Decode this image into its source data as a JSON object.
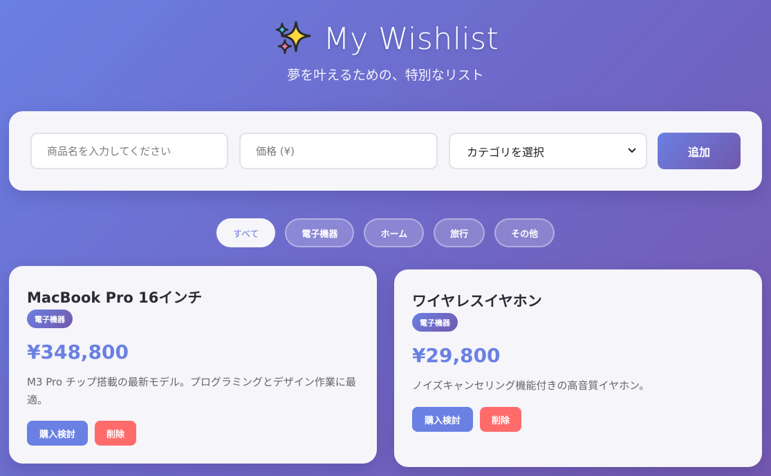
{
  "header": {
    "title": "My Wishlist",
    "subtitle": "夢を叶えるための、特別なリスト",
    "icon": "sparkles-icon"
  },
  "form": {
    "name_placeholder": "商品名を入力してください",
    "price_placeholder": "価格 (¥)",
    "category_selected": "カテゴリを選択",
    "add_label": "追加"
  },
  "filters": [
    {
      "label": "すべて",
      "active": true
    },
    {
      "label": "電子機器",
      "active": false
    },
    {
      "label": "ホーム",
      "active": false
    },
    {
      "label": "旅行",
      "active": false
    },
    {
      "label": "その他",
      "active": false
    }
  ],
  "items": [
    {
      "name": "MacBook Pro 16インチ",
      "category": "電子機器",
      "price": "¥348,800",
      "description": "M3 Pro チップ搭載の最新モデル。プログラミングとデザイン作業に最適。",
      "consider_label": "購入検討",
      "delete_label": "削除"
    },
    {
      "name": "ワイヤレスイヤホン",
      "category": "電子機器",
      "price": "¥29,800",
      "description": "ノイズキャンセリング機能付きの高音質イヤホン。",
      "consider_label": "購入検討",
      "delete_label": "削除"
    }
  ],
  "colors": {
    "accent": "#6a80e2",
    "accent_dark": "#7258ad",
    "delete": "#ff6b6b",
    "card_bg": "#f6f5fa"
  }
}
